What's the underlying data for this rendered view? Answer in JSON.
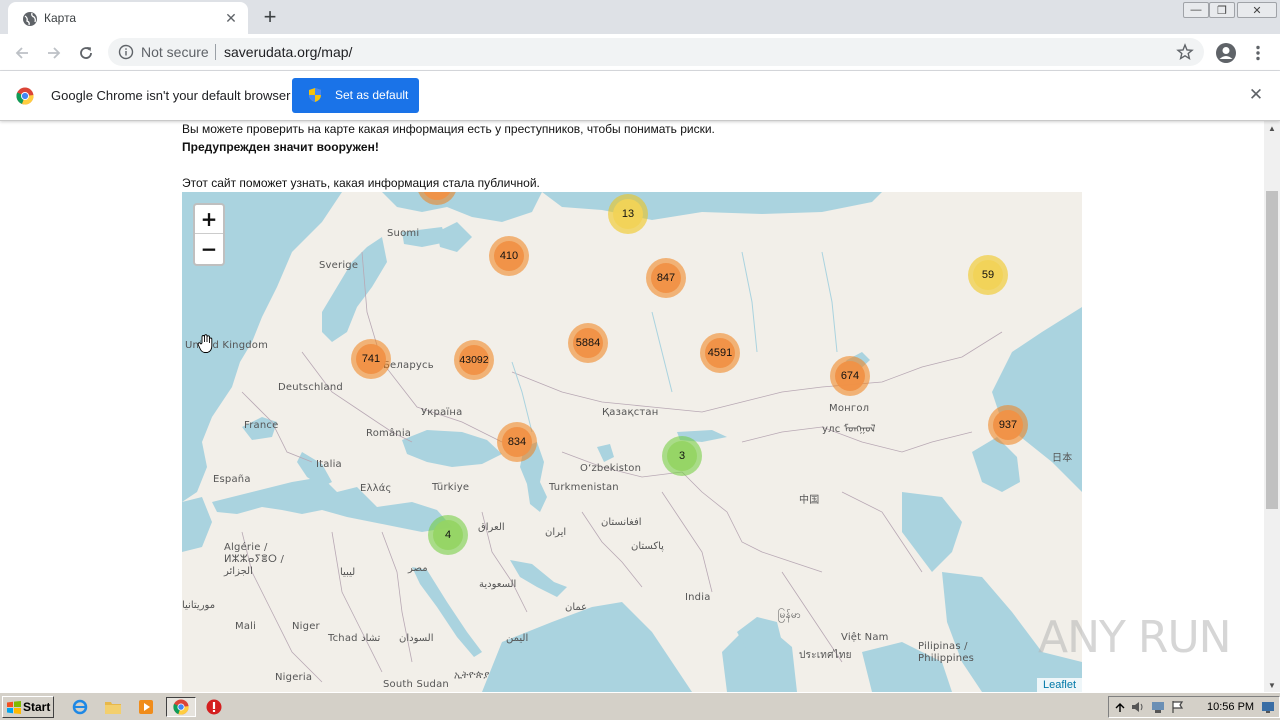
{
  "browser": {
    "tab_title": "Карта",
    "tab_close": "✕",
    "new_tab": "+",
    "address": {
      "security_label": "Not secure",
      "url": "saverudata.org/map/"
    },
    "window_controls": {
      "minimize": "—",
      "restore": "❐",
      "close": "✕"
    }
  },
  "infobar": {
    "message": "Google Chrome isn't your default browser",
    "button_label": "Set as default",
    "close": "✕"
  },
  "page": {
    "intro_line": "Вы можете проверить на карте какая информация есть у преступников, чтобы понимать риски.",
    "warning_line": "Предупрежден значит вооружен!",
    "site_line": "Этот сайт поможет узнать, какая информация стала публичной."
  },
  "map": {
    "zoom_in": "+",
    "zoom_out": "−",
    "attribution": "Leaflet",
    "labels": [
      "Suomi",
      "Sverige",
      "United Kingdom",
      "Deutschland",
      "France",
      "Беларусь",
      "Україна",
      "România",
      "Italia",
      "España",
      "Ελλάς",
      "Türkiye",
      "Қазақстан",
      "O‘zbekiston",
      "Turkmenistan",
      "Монгол",
      "улс ᠮᠣᠩᠭᠣᠯ",
      "中国",
      "日本",
      "العراق",
      "ایران",
      "افغانستان",
      "پاکستان",
      "Algérie / ⵍⵣⵣⴰⵢⴻⵔ / الجزائر",
      "مصر",
      "ليبيا",
      "السعودية",
      "India",
      "عمان",
      "اليمن",
      "Mali",
      "Niger",
      "Tchad تشاد",
      "السودان",
      "Nigeria",
      "South Sudan",
      "ኢትዮጵያ",
      "موريتانيا",
      "Việt Nam",
      "Pilipinas / Philippines",
      "ประเทศไทย",
      "မြန်မာ"
    ],
    "clusters": [
      {
        "count": "13",
        "level": "yellow"
      },
      {
        "count": "410",
        "level": "orange"
      },
      {
        "count": "847",
        "level": "orange"
      },
      {
        "count": "59",
        "level": "yellow"
      },
      {
        "count": "741",
        "level": "orange"
      },
      {
        "count": "43092",
        "level": "orange"
      },
      {
        "count": "5884",
        "level": "orange"
      },
      {
        "count": "4591",
        "level": "orange"
      },
      {
        "count": "674",
        "level": "orange"
      },
      {
        "count": "937",
        "level": "orange"
      },
      {
        "count": "834",
        "level": "orange"
      },
      {
        "count": "3",
        "level": "green"
      },
      {
        "count": "4",
        "level": "green"
      }
    ]
  },
  "watermark": "ANY RUN",
  "taskbar": {
    "start_label": "Start",
    "clock": "10:56 PM"
  },
  "colors": {
    "accent": "#1a73e8",
    "map_land": "#f2efe9",
    "map_water": "#aad3df",
    "cluster_orange": "#f09146",
    "cluster_yellow": "#f1d357",
    "cluster_green": "#95d464"
  }
}
